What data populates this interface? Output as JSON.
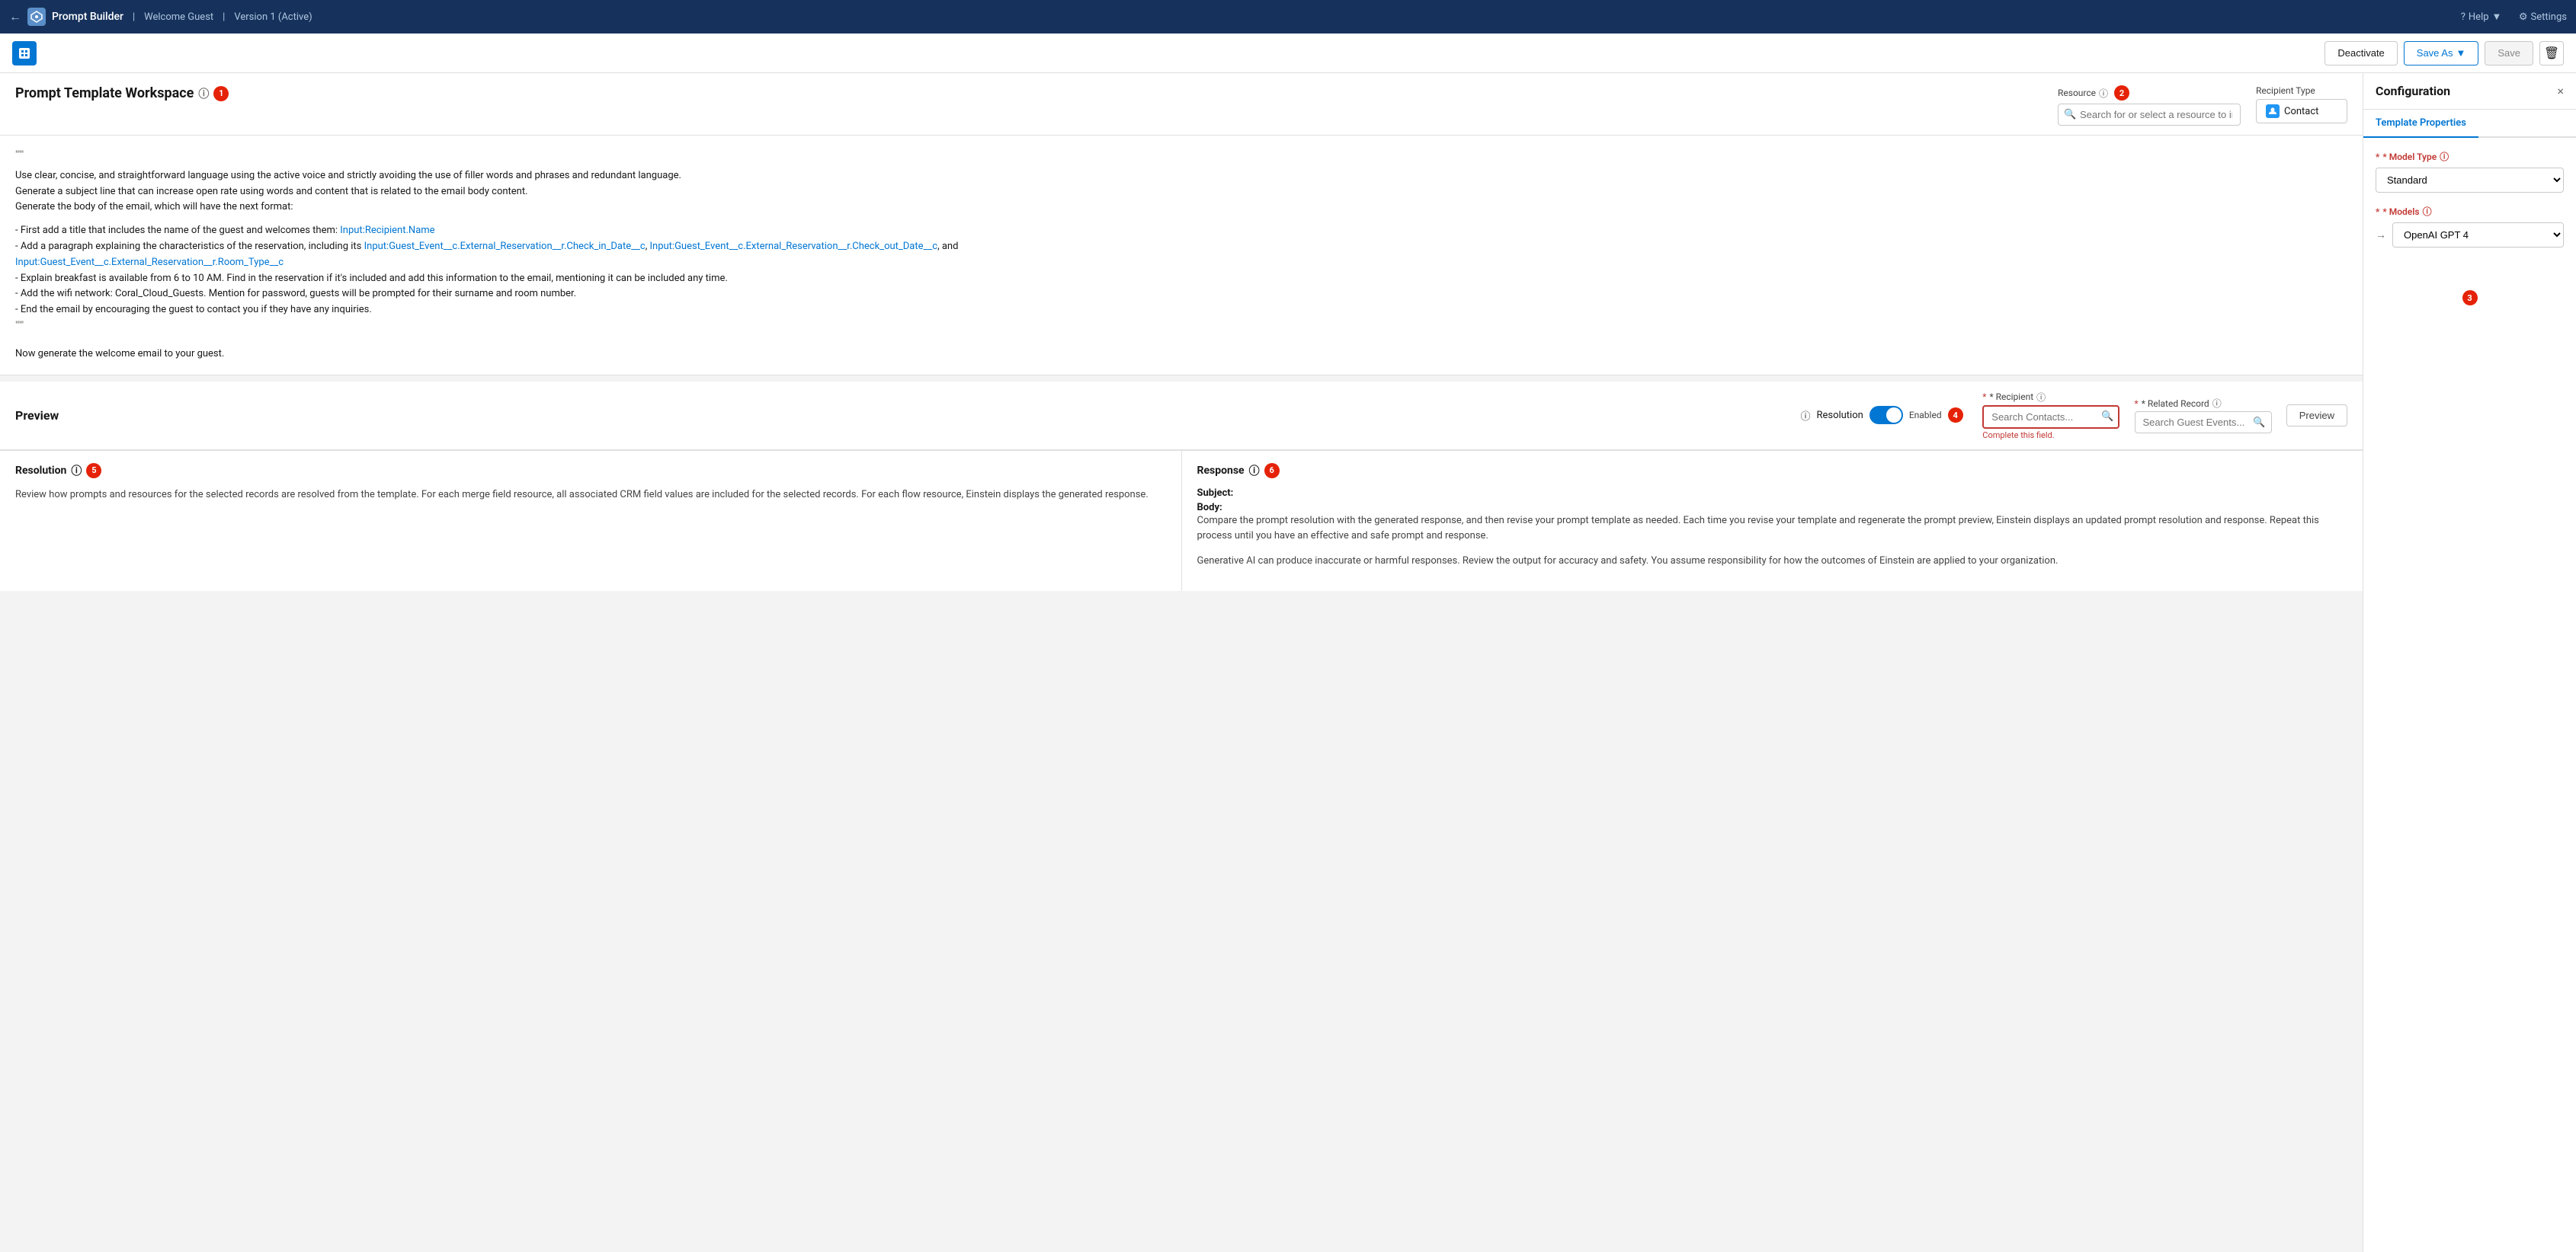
{
  "topnav": {
    "back_icon": "←",
    "app_icon": "⚡",
    "app_name": "Prompt Builder",
    "breadcrumb_welcome": "Welcome Guest",
    "breadcrumb_version": "Version 1 (Active)",
    "help_label": "Help",
    "settings_label": "Settings"
  },
  "toolbar": {
    "deactivate_label": "Deactivate",
    "save_as_label": "Save As",
    "save_label": "Save",
    "delete_icon": "🗑"
  },
  "workspace": {
    "title": "Prompt Template Workspace",
    "info_icon": "ⓘ",
    "step1_badge": "1",
    "step2_badge": "2",
    "resource_label": "Resource",
    "resource_info": "ⓘ",
    "resource_placeholder": "Search for or select a resource to insert .",
    "recipient_type_label": "Recipient Type",
    "recipient_type_value": "Contact"
  },
  "editor": {
    "quote_open": "\"\"\"",
    "line1": "Use clear, concise, and straightforward language using the active voice and strictly avoiding the use of filler words and phrases and redundant language.",
    "line2": "Generate a subject line that can increase open rate using words and content that is related to the email body content.",
    "line3": "Generate the body of the email, which will have the next format:",
    "bullet1_prefix": "- First add a title that includes the name of the guest and welcomes them: ",
    "bullet1_link": "Input:Recipient.Name",
    "bullet2_prefix": "- Add a paragraph explaining the characteristics of the reservation, including its ",
    "bullet2_link1": "Input:Guest_Event__c.External_Reservation__r.Check_in_Date__c",
    "bullet2_mid": ", ",
    "bullet2_link2": "Input:Guest_Event__c.External_Reservation__r.Check_out_Date__c",
    "bullet2_suffix": ", and",
    "bullet2_link3": "Input:Guest_Event__c.External_Reservation__r.Room_Type__c",
    "bullet3": "- Explain breakfast is available from 6 to 10 AM. Find in the reservation if it's included and add this information to the email, mentioning it can be included any time.",
    "bullet4": "- Add the wifi network: Coral_Cloud_Guests. Mention for password, guests will be prompted for their surname and room number.",
    "bullet5": "- End the email by encouraging the guest to contact you if they have any inquiries.",
    "quote_close": "\"\"\"",
    "closing": "Now generate the welcome email to your guest."
  },
  "preview": {
    "title": "Preview",
    "step4_badge": "4",
    "resolution_label": "Resolution",
    "resolution_info": "ⓘ",
    "toggle_enabled": "Enabled",
    "recipient_label": "* Recipient",
    "recipient_info": "ⓘ",
    "search_contacts_placeholder": "Search Contacts...",
    "complete_field_error": "Complete this field.",
    "related_record_label": "* Related Record",
    "related_record_info": "ⓘ",
    "search_guest_events_placeholder": "Search Guest Events...",
    "preview_button_label": "Preview"
  },
  "resolution_panel": {
    "title": "Resolution",
    "info": "ⓘ",
    "step5_badge": "5",
    "text": "Review how prompts and resources for the selected records are resolved from the template. For each merge field resource, all associated CRM field values are included for the selected records. For each flow resource, Einstein displays the generated response."
  },
  "response_panel": {
    "title": "Response",
    "info": "ⓘ",
    "step6_badge": "6",
    "subject_label": "Subject:",
    "body_label": "Body:",
    "response_text1": "Compare the prompt resolution with the generated response, and then revise your prompt template as needed. Each time you revise your template and regenerate the prompt preview, Einstein displays an updated prompt resolution and response. Repeat this process until you have an effective and safe prompt and response.",
    "response_text2": "Generative AI can produce inaccurate or harmful responses. Review the output for accuracy and safety. You assume responsibility for how the outcomes of Einstein are applied to your organization."
  },
  "config": {
    "title": "Configuration",
    "close_icon": "×",
    "tab_template_properties": "Template Properties",
    "model_type_label": "* Model Type",
    "model_type_info": "ⓘ",
    "model_type_value": "Standard",
    "models_label": "* Models",
    "models_info": "ⓘ",
    "model_value": "OpenAI GPT 4",
    "step3_badge": "3"
  }
}
